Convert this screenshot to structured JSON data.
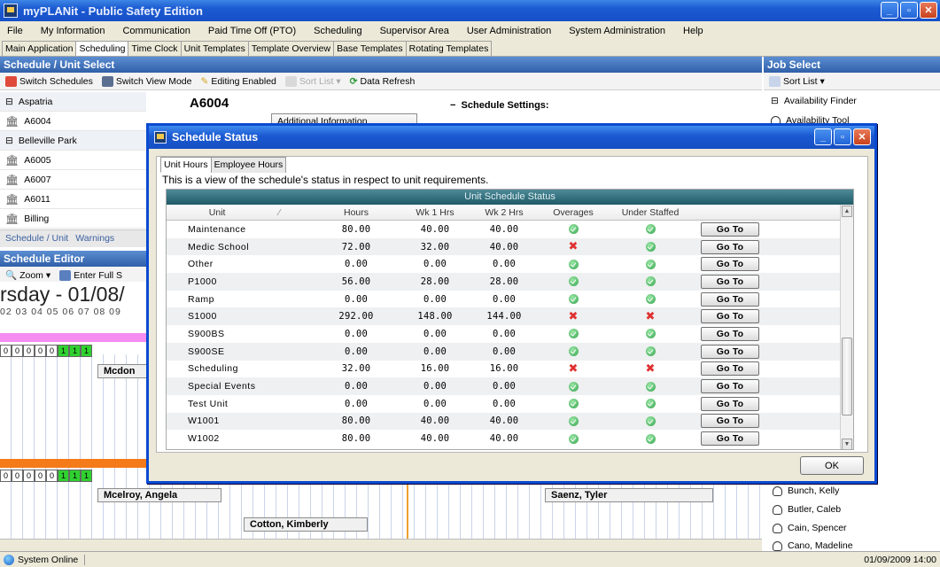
{
  "app": {
    "title": "myPLANit - Public Safety Edition"
  },
  "menu": [
    "File",
    "My Information",
    "Communication",
    "Paid Time Off (PTO)",
    "Scheduling",
    "Supervisor Area",
    "User Administration",
    "System Administration",
    "Help"
  ],
  "tabs": [
    "Main Application",
    "Scheduling",
    "Time Clock",
    "Unit Templates",
    "Template Overview",
    "Base Templates",
    "Rotating Templates"
  ],
  "active_tab": "Scheduling",
  "schedule_select": {
    "header": "Schedule / Unit Select",
    "toolbar": {
      "switch_schedules": "Switch Schedules",
      "switch_view": "Switch View Mode",
      "editing": "Editing Enabled",
      "sort_list": "Sort List",
      "refresh": "Data Refresh"
    },
    "items": [
      {
        "label": "Aspatria",
        "group": true
      },
      {
        "label": "A6004",
        "group": false
      },
      {
        "label": "Belleville Park",
        "group": true
      },
      {
        "label": "A6005",
        "group": false
      },
      {
        "label": "A6007",
        "group": false
      },
      {
        "label": "A6011",
        "group": false
      },
      {
        "label": "Billing",
        "group": false
      }
    ],
    "bottom_tabs": [
      "Schedule / Unit",
      "Warnings"
    ],
    "unit_name": "A6004",
    "additional_info": "Additional Information",
    "schedule_settings": "Schedule Settings:"
  },
  "editor": {
    "header": "Schedule Editor",
    "zoom": "Zoom",
    "enter_full": "Enter Full S",
    "date": "rsday - 01/08/",
    "hours": "02 03 04 05 06 07 08 09",
    "counts": [
      "0",
      "0",
      "0",
      "0",
      "0",
      "1",
      "1",
      "1"
    ],
    "names": {
      "mcdon": "Mcdon",
      "mcelroy": "Mcelroy, Angela",
      "saenz": "Saenz, Tyler",
      "cotton": "Cotton, Kimberly"
    }
  },
  "job_select": {
    "header": "Job Select",
    "sort_list": "Sort List",
    "items": [
      "Availability Finder",
      "Availability Tool"
    ],
    "people": [
      "Bunch, Kelly",
      "Butler, Caleb",
      "Cain, Spencer",
      "Cano, Madeline"
    ]
  },
  "dialog": {
    "title": "Schedule Status",
    "tabs": [
      "Unit Hours",
      "Employee Hours"
    ],
    "description": "This is a view of the schedule's status in respect to unit requirements.",
    "table_title": "Unit Schedule Status",
    "columns": [
      "Unit",
      "Hours",
      "Wk 1 Hrs",
      "Wk 2 Hrs",
      "Overages",
      "Under Staffed"
    ],
    "goto_label": "Go To",
    "rows": [
      {
        "unit": "Maintenance",
        "hours": "80.00",
        "wk1": "40.00",
        "wk2": "40.00",
        "overages": "ok",
        "under": "ok"
      },
      {
        "unit": "Medic School",
        "hours": "72.00",
        "wk1": "32.00",
        "wk2": "40.00",
        "overages": "x",
        "under": "ok"
      },
      {
        "unit": "Other",
        "hours": "0.00",
        "wk1": "0.00",
        "wk2": "0.00",
        "overages": "ok",
        "under": "ok"
      },
      {
        "unit": "P1000",
        "hours": "56.00",
        "wk1": "28.00",
        "wk2": "28.00",
        "overages": "ok",
        "under": "ok"
      },
      {
        "unit": "Ramp",
        "hours": "0.00",
        "wk1": "0.00",
        "wk2": "0.00",
        "overages": "ok",
        "under": "ok"
      },
      {
        "unit": "S1000",
        "hours": "292.00",
        "wk1": "148.00",
        "wk2": "144.00",
        "overages": "x",
        "under": "x"
      },
      {
        "unit": "S900BS",
        "hours": "0.00",
        "wk1": "0.00",
        "wk2": "0.00",
        "overages": "ok",
        "under": "ok"
      },
      {
        "unit": "S900SE",
        "hours": "0.00",
        "wk1": "0.00",
        "wk2": "0.00",
        "overages": "ok",
        "under": "ok"
      },
      {
        "unit": "Scheduling",
        "hours": "32.00",
        "wk1": "16.00",
        "wk2": "16.00",
        "overages": "x",
        "under": "x"
      },
      {
        "unit": "Special Events",
        "hours": "0.00",
        "wk1": "0.00",
        "wk2": "0.00",
        "overages": "ok",
        "under": "ok"
      },
      {
        "unit": "Test Unit",
        "hours": "0.00",
        "wk1": "0.00",
        "wk2": "0.00",
        "overages": "ok",
        "under": "ok"
      },
      {
        "unit": "W1001",
        "hours": "80.00",
        "wk1": "40.00",
        "wk2": "40.00",
        "overages": "ok",
        "under": "ok"
      },
      {
        "unit": "W1002",
        "hours": "80.00",
        "wk1": "40.00",
        "wk2": "40.00",
        "overages": "ok",
        "under": "ok"
      }
    ],
    "ok_label": "OK"
  },
  "status": {
    "left": "System Online",
    "datetime": "01/09/2009 14:00"
  }
}
